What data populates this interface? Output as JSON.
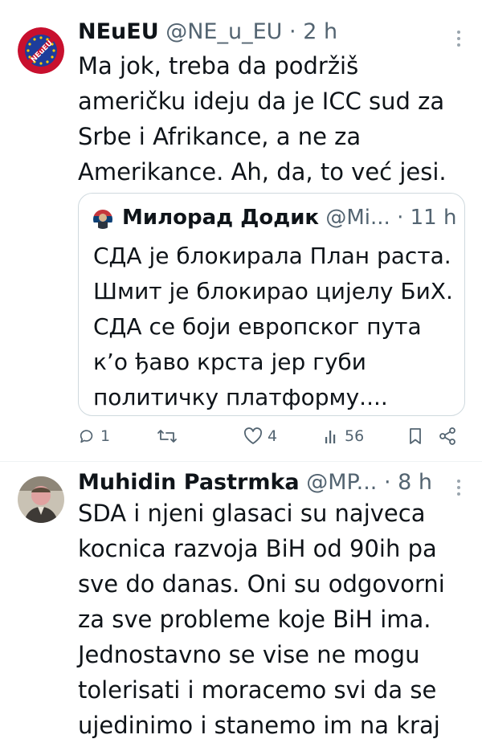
{
  "tweets": [
    {
      "name": "NEuEU",
      "handle": "@NE_u_EU",
      "time": "· 2 h",
      "avatar_icon": "neueu-logo",
      "text": "Ma jok, treba da podržiš američku ideju da je ICC sud za Srbe i Afrikance, a ne za Amerikance. Ah, da, to već jesi.",
      "quote": {
        "name": "Милорад Додик",
        "handle": "@Mi...",
        "time": "· 11 h",
        "text": "СДА је блокирала План раста. Шмит је блокирао цијелу БиХ. СДА се боји европског пута к’о ђаво крста јер губи политичку платформу...."
      },
      "actions": {
        "replies": "1",
        "retweets": "",
        "likes": "4",
        "views": "56"
      }
    },
    {
      "name": "Muhidin Pastrmka",
      "handle": "@MP...",
      "time": "· 8 h",
      "avatar_icon": "user-photo",
      "text": "SDA i njeni glasaci su najveca kocnica razvoja BiH od 90ih pa sve do danas. Oni su odgovorni za sve probleme koje BiH ima. Jednostavno se vise ne mogu tolerisati i moracemo svi da se ujedinimo i stanemo im na kraj"
    }
  ],
  "colors": {
    "text": "#0f1419",
    "muted": "#536471",
    "border": "#cfd9de",
    "neueu_red": "#c8102e",
    "eu_blue": "#1d3d9b",
    "eu_star": "#ffcc00"
  }
}
